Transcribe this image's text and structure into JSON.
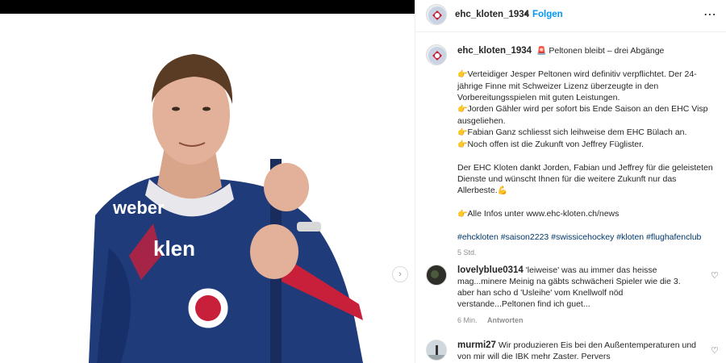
{
  "colors": {
    "accent": "#0095f6",
    "text": "#262626",
    "muted": "#8e8e8e",
    "hashtag": "#00376b"
  },
  "header": {
    "username": "ehc_kloten_1934",
    "dot": "•",
    "follow_label": "Folgen",
    "more_icon": "⋯"
  },
  "caption": {
    "username": "ehc_kloten_1934",
    "title_emoji": "🚨",
    "title": "Peltonen bleibt – drei Abgänge",
    "pointer_emoji": "👉",
    "line1": "Verteidiger Jesper Peltonen wird definitiv verpflichtet. Der 24-jährige Finne mit Schweizer Lizenz überzeugte in den Vorbereitungsspielen mit guten Leistungen.",
    "line2": "Jorden Gähler wird per sofort bis Ende Saison an den EHC Visp ausgeliehen.",
    "line3": "Fabian Ganz schliesst sich leihweise dem EHC Bülach an.",
    "line4": "Noch offen ist die Zukunft von Jeffrey Füglister.",
    "thanks": "Der EHC Kloten dankt Jorden, Fabian und Jeffrey für die geleisteten Dienste und wünscht Ihnen für die weitere Zukunft nur das Allerbeste.",
    "muscle_emoji": "💪",
    "info": "Alle Infos unter www.ehc-kloten.ch/news",
    "hashtags": "#ehckloten #saison2223 #swissicehockey #kloten #flughafenclub",
    "time": "5 Std."
  },
  "comments": [
    {
      "username": "lovelyblue0314",
      "text": "'leiweise' was au immer das heisse mag...minere Meinig na gäbts schwächeri Spieler wie die 3. aber han scho d 'Usleihe' vom Knellwolf nöd verstande...Peltonen find ich guet...",
      "time": "6 Min.",
      "reply": "Antworten"
    },
    {
      "username": "murmi27",
      "text": "Wir produzieren Eis bei den Außentemperaturen und von mir will die IBK mehr Zaster. Pervers"
    }
  ],
  "icons": {
    "next": "chevron-right-icon",
    "heart": "heart-icon",
    "more": "more-options-icon"
  }
}
